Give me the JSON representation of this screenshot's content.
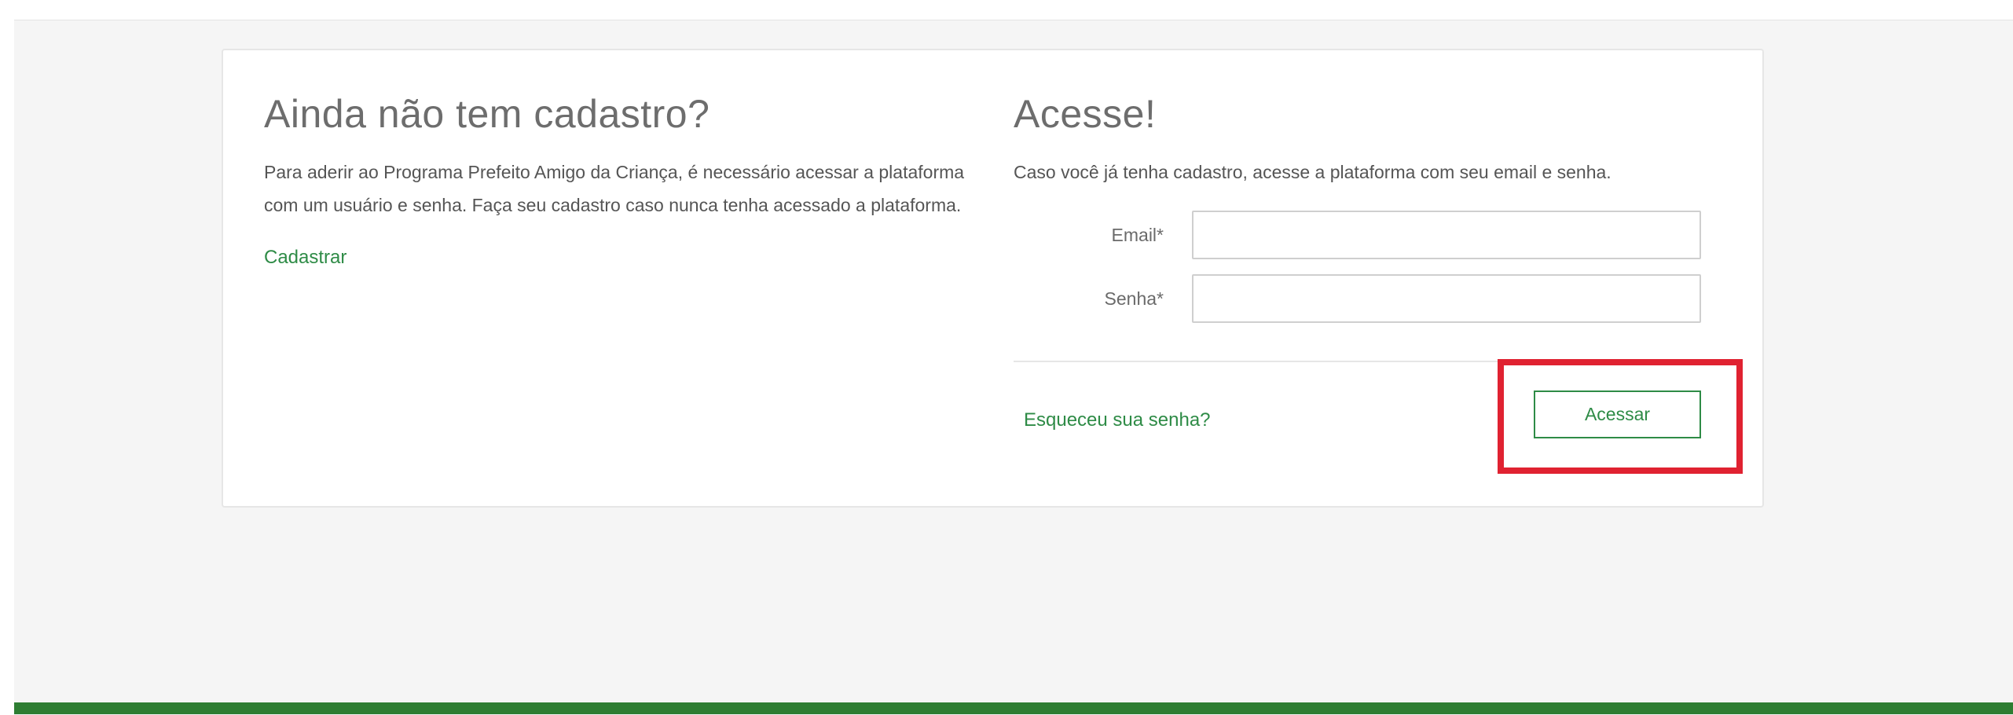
{
  "register": {
    "heading": "Ainda não tem cadastro?",
    "description": "Para aderir ao Programa Prefeito Amigo da Criança, é necessário acessar a plataforma com um usuário e senha. Faça seu cadastro caso nunca tenha acessado a plataforma.",
    "link_label": "Cadastrar"
  },
  "login": {
    "heading": "Acesse!",
    "description": "Caso você já tenha cadastro, acesse a plataforma com seu email e senha.",
    "email_label": "Email*",
    "email_value": "",
    "password_label": "Senha*",
    "password_value": "",
    "forgot_label": "Esqueceu sua senha?",
    "submit_label": "Acessar"
  },
  "colors": {
    "accent_green": "#2e8b46",
    "footer_green": "#2e7d32",
    "highlight_red": "#e02231"
  }
}
